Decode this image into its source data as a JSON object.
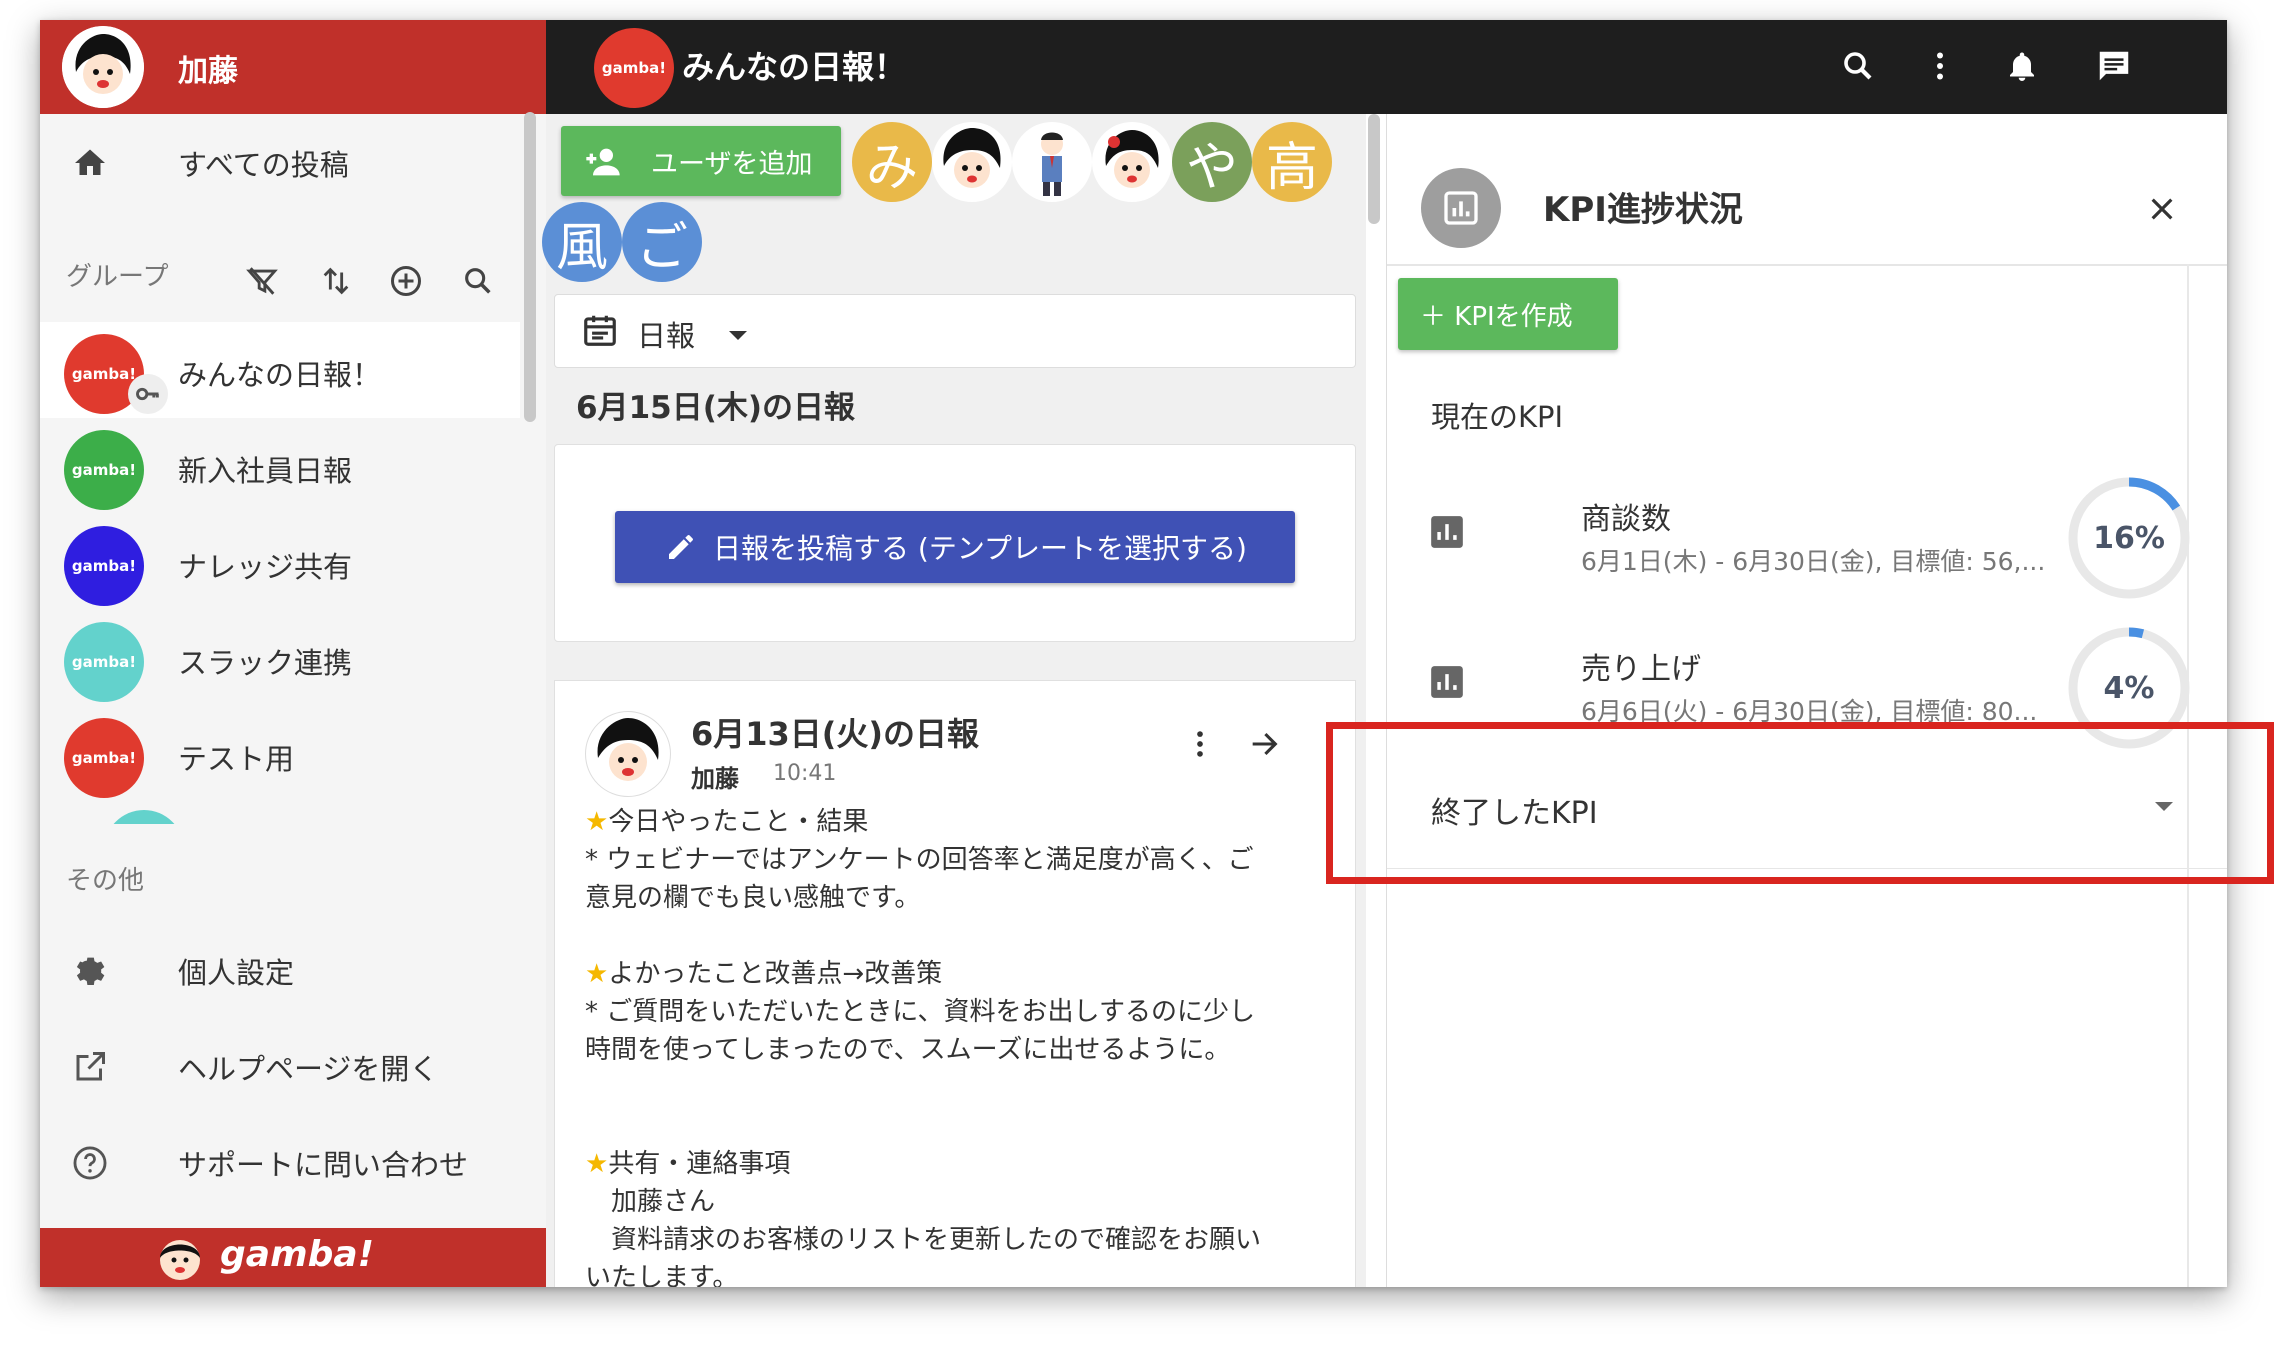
{
  "sidebar": {
    "username": "加藤",
    "nav_all_posts": "すべての投稿",
    "groups_label": "グループ",
    "groups": [
      {
        "label": "みんなの日報！",
        "logo": "gamba!",
        "color": "#e03a2e"
      },
      {
        "label": "新入社員日報",
        "logo": "gamba!",
        "color": "#3cae49"
      },
      {
        "label": "ナレッジ共有",
        "logo": "gamba!",
        "color": "#2f1ee0"
      },
      {
        "label": "スラック連携",
        "logo": "gamba!",
        "color": "#63d2cc"
      },
      {
        "label": "テスト用",
        "logo": "gamba!",
        "color": "#e03a2e"
      }
    ],
    "other_label": "その他",
    "personal_settings": "個人設定",
    "help_page": "ヘルプページを開く",
    "contact_support": "サポートに問い合わせ",
    "footer_brand": "gamba!"
  },
  "topbar": {
    "logo_text": "gamba!",
    "title": "みんなの日報！",
    "icons": [
      "search-icon",
      "more-vert-icon",
      "bell-icon",
      "chat-icon"
    ]
  },
  "center": {
    "add_user_label": "ユーザを追加",
    "members": [
      {
        "char": "み",
        "color": "#e9b949"
      },
      {
        "char": "",
        "color": "#ffffff"
      },
      {
        "char": "",
        "color": "#ffffff"
      },
      {
        "char": "",
        "color": "#ffffff"
      },
      {
        "char": "や",
        "color": "#7ba05b"
      },
      {
        "char": "高",
        "color": "#e9b949"
      },
      {
        "char": "風",
        "color": "#5b8fd6"
      },
      {
        "char": "ご",
        "color": "#5b8fd6"
      }
    ],
    "filter_label": "日報",
    "date_heading": "6月15日(木)の日報",
    "post_button_label": "日報を投稿する (テンプレートを選択する)",
    "report": {
      "title": "6月13日(火)の日報",
      "author": "加藤",
      "time": "10:41",
      "lines": [
        "★今日やったこと・結果",
        "* ウェビナーではアンケートの回答率と満足度が高く、ご",
        "意見の欄でも良い感触です。",
        "",
        "★よかったこと改善点→改善策",
        "* ご質問をいただいたときに、資料をお出しするのに少し",
        "時間を使ってしまったので、スムーズに出せるように。",
        "",
        "",
        "★共有・連絡事項",
        "　加藤さん",
        "　資料請求のお客様のリストを更新したので確認をお願い",
        "いたします。"
      ]
    }
  },
  "kpi": {
    "title": "KPI進捗状況",
    "create_label": "＋ KPIを作成",
    "current_label": "現在のKPI",
    "items": [
      {
        "name": "商談数",
        "period": "6月1日(木) - 6月30日(金), 目標値: 56,...",
        "percent_label": "16%",
        "progress": 0.16
      },
      {
        "name": "売り上げ",
        "period": "6月6日(火) - 6月30日(金), 目標値: 80...",
        "percent_label": "4%",
        "progress": 0.04
      }
    ],
    "ended_label": "終了したKPI",
    "ring_color": "#4a90e2",
    "ring_track": "#e8e8e8"
  },
  "highlight_color": "#d9251f"
}
